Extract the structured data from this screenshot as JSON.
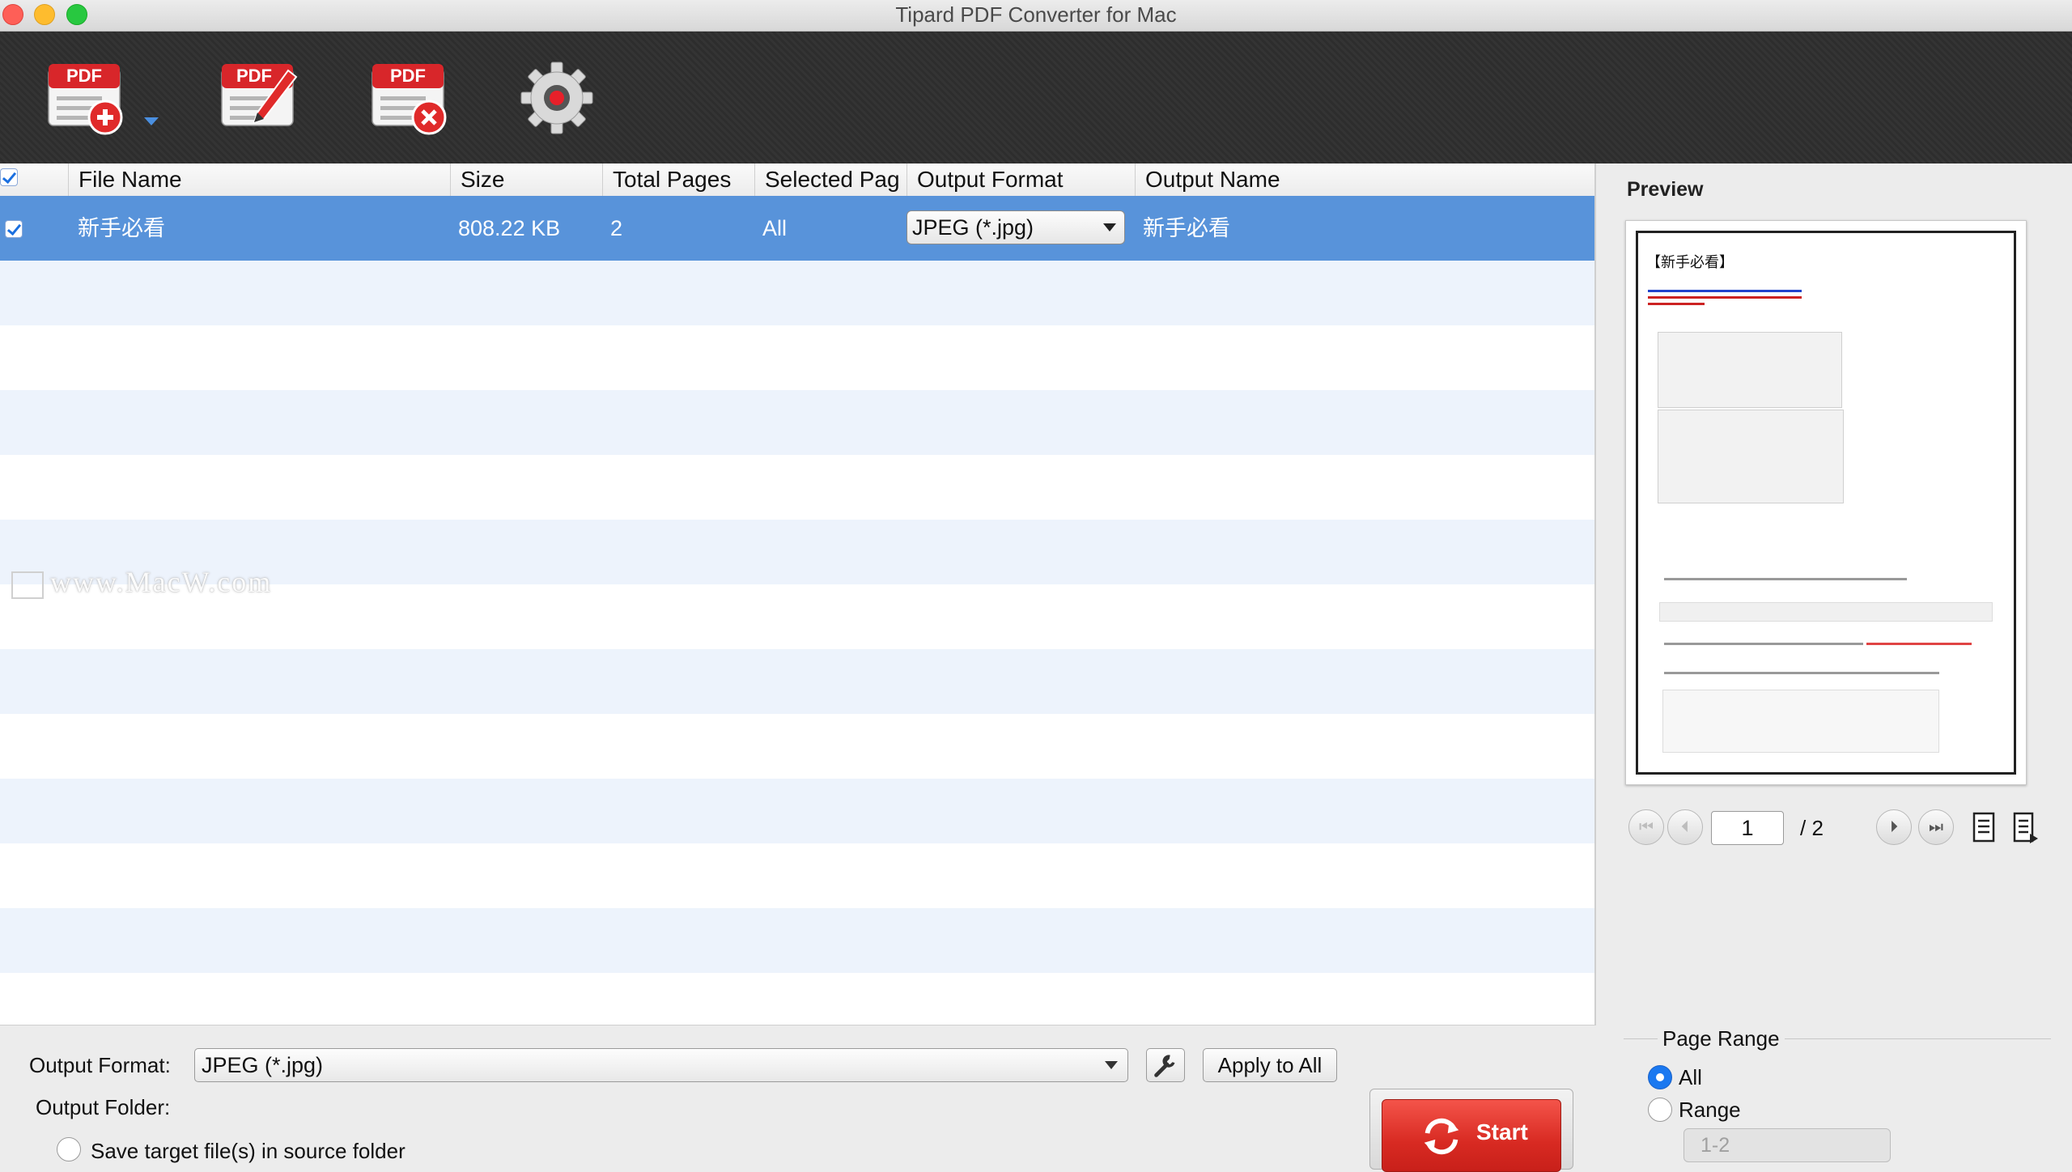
{
  "window": {
    "title": "Tipard PDF Converter for Mac"
  },
  "toolbar": {
    "add_label": "PDF",
    "edit_label": "PDF",
    "remove_label": "PDF"
  },
  "table": {
    "headers": [
      "File Name",
      "Size",
      "Total Pages",
      "Selected Pag",
      "Output Format",
      "Output Name"
    ],
    "rows": [
      {
        "checked": true,
        "file_name": "新手必看",
        "size": "808.22 KB",
        "total_pages": "2",
        "selected_pages": "All",
        "output_format": "JPEG (*.jpg)",
        "output_name": "新手必看"
      }
    ]
  },
  "watermark": "www.MacW.com",
  "bottom": {
    "output_format_label": "Output Format:",
    "output_format_value": "JPEG (*.jpg)",
    "apply_all_label": "Apply to All",
    "output_folder_label": "Output Folder:",
    "save_source_label": "Save target file(s) in source folder",
    "start_label": "Start"
  },
  "preview": {
    "title": "Preview",
    "current_page": "1",
    "total_pages": "/ 2",
    "page_heading": "【新手必看】"
  },
  "page_range": {
    "legend": "Page Range",
    "all_label": "All",
    "range_label": "Range",
    "range_placeholder": "1-2"
  },
  "colors": {
    "selected_row": "#5893da",
    "accent_blue": "#1a78f0",
    "start_red": "#d82a22",
    "pdf_red": "#d8262a"
  }
}
